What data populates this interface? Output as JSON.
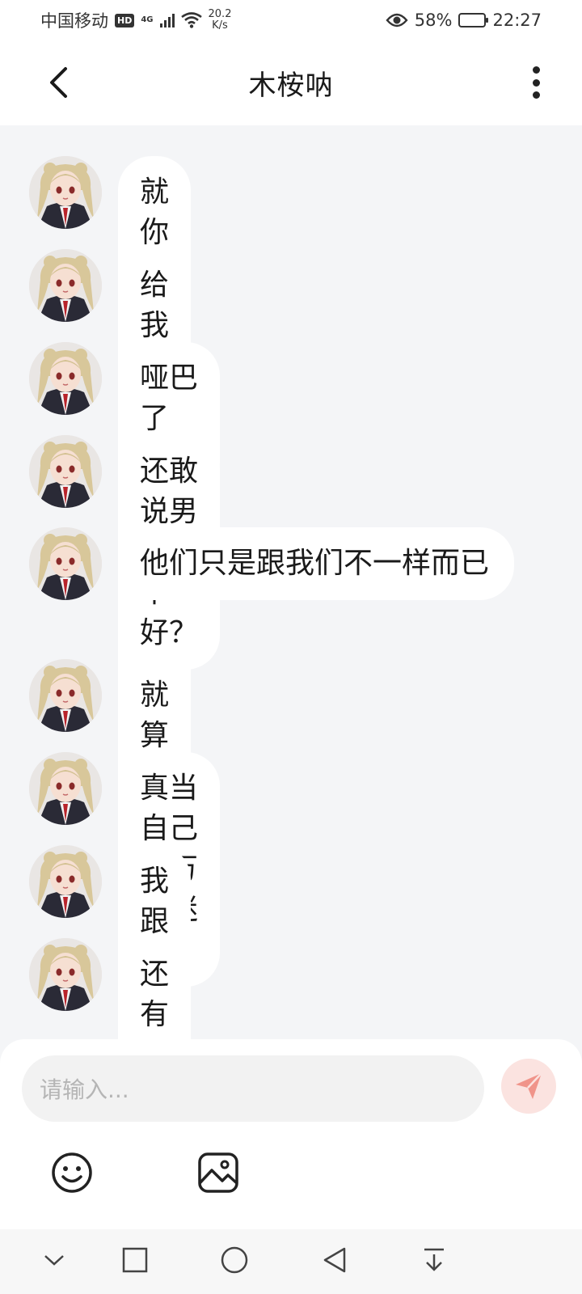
{
  "status_bar": {
    "carrier": "中国移动",
    "hd": "HD",
    "network": "4G",
    "speed_value": "20.2",
    "speed_unit": "K/s",
    "battery": "58%",
    "battery_level": 0.58,
    "time": "22:27"
  },
  "header": {
    "title": "木桉呐"
  },
  "messages": [
    {
      "text": "就你这样的"
    },
    {
      "text": "给我姐妹提鞋都不配好吧"
    },
    {
      "text": "哑巴了吗？"
    },
    {
      "text": "还敢说男男恋不好？"
    },
    {
      "text": "他们只是跟我们不一样而已"
    },
    {
      "text": "就算男恋恋也不找你好吧"
    },
    {
      "text": "真当自己是万人迷吗？"
    },
    {
      "text": "我跟你讲"
    },
    {
      "text": "还有"
    }
  ],
  "composer": {
    "placeholder": "请输入..."
  },
  "colors": {
    "bubble": "#ffffff",
    "background": "#f4f5f7",
    "send_button": "#fbe3e0",
    "send_icon": "#f0948a"
  }
}
